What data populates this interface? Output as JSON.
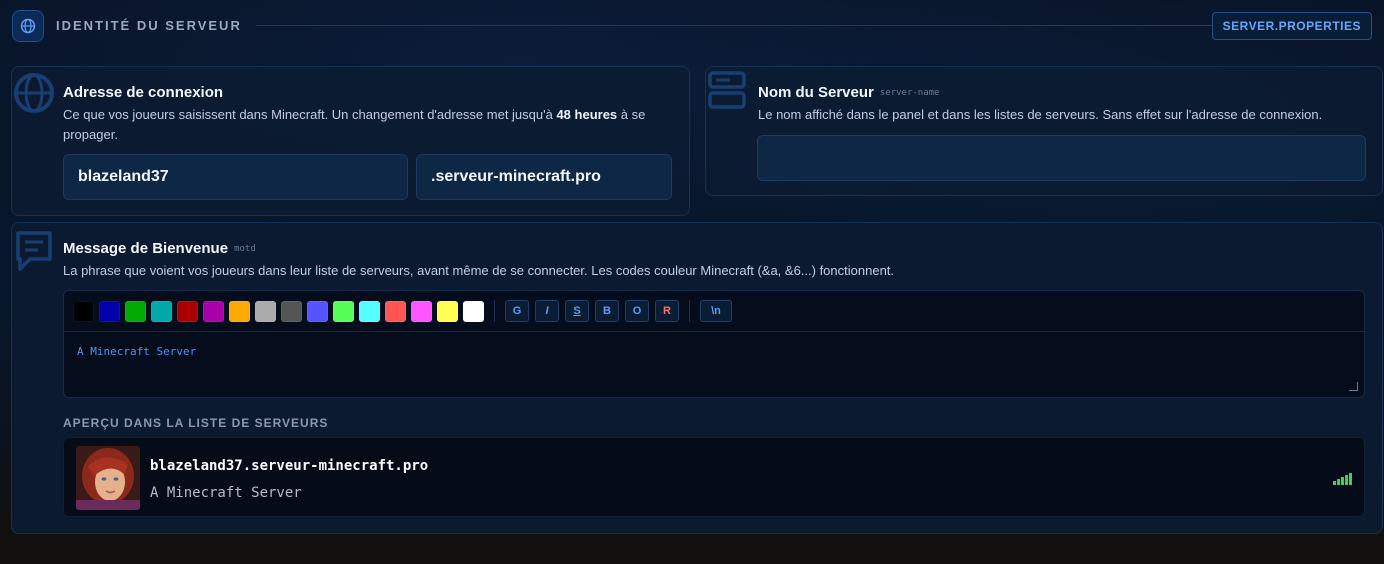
{
  "header": {
    "title": "IDENTITÉ DU SERVEUR",
    "server_properties_button": "SERVER.PROPERTIES"
  },
  "address_card": {
    "title": "Adresse de connexion",
    "desc_before": "Ce que vos joueurs saisissent dans Minecraft. Un changement d'adresse met jusqu'à ",
    "desc_bold": "48 heures",
    "desc_after": " à se propager.",
    "subdomain_value": "blazeland37",
    "domain_value": ".serveur-minecraft.pro"
  },
  "name_card": {
    "title": "Nom du Serveur",
    "key": "server-name",
    "desc": "Le nom affiché dans le panel et dans les listes de serveurs. Sans effet sur l'adresse de connexion.",
    "input_value": ""
  },
  "motd_card": {
    "title": "Message de Bienvenue",
    "key": "motd",
    "desc": "La phrase que voient vos joueurs dans leur liste de serveurs, avant même de se connecter. Les codes couleur Minecraft (&a, &6...) fonctionnent.",
    "colors": [
      "#000000",
      "#0000aa",
      "#00aa00",
      "#00aaaa",
      "#aa0000",
      "#aa00aa",
      "#ffaa00",
      "#aaaaaa",
      "#555555",
      "#5555ff",
      "#55ff55",
      "#55ffff",
      "#ff5555",
      "#ff55ff",
      "#ffff55",
      "#ffffff"
    ],
    "format_buttons": [
      "G",
      "I",
      "S",
      "B",
      "O",
      "R"
    ],
    "newline_button": "\\n",
    "textarea_value": "A Minecraft Server",
    "preview_label": "APERÇU DANS LA LISTE DE SERVEURS",
    "preview_title": "blazeland37.serveur-minecraft.pro",
    "preview_motd": "A Minecraft Server"
  },
  "accents": {
    "primary": "#3b82f6",
    "signal": "#3ecf5e",
    "reset_button": "#f87171"
  }
}
